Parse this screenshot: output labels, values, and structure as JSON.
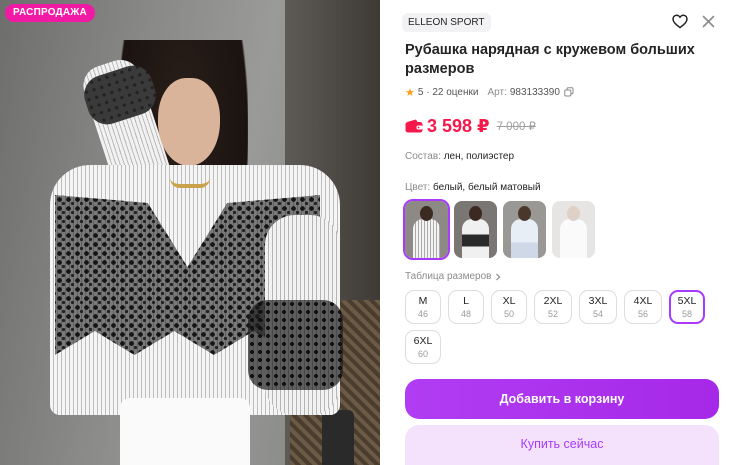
{
  "badge": {
    "sale": "РАСПРОДАЖА"
  },
  "product": {
    "brand": "ELLEON SPORT",
    "title": "Рубашка нарядная с кружевом больших размеров",
    "rating": "5",
    "reviews": "22 оценки",
    "article_label": "Арт:",
    "article": "983133390",
    "price": "3 598 ₽",
    "old_price": "7 000 ₽",
    "composition_label": "Состав:",
    "composition": "лен, полиэстер",
    "color_label": "Цвет:",
    "color": "белый, белый матовый"
  },
  "sizes": {
    "table_label": "Таблица размеров",
    "items": [
      {
        "size": "M",
        "ru": "46"
      },
      {
        "size": "L",
        "ru": "48"
      },
      {
        "size": "XL",
        "ru": "50"
      },
      {
        "size": "2XL",
        "ru": "52"
      },
      {
        "size": "3XL",
        "ru": "54"
      },
      {
        "size": "4XL",
        "ru": "56"
      },
      {
        "size": "5XL",
        "ru": "58"
      },
      {
        "size": "6XL",
        "ru": "60"
      }
    ],
    "selected": "5XL"
  },
  "actions": {
    "add_to_cart": "Добавить в корзину",
    "buy_now": "Купить сейчас"
  },
  "colors": {
    "accent": "#a73afd",
    "price": "#f5184a",
    "sale_badge": "#f01aa5"
  }
}
